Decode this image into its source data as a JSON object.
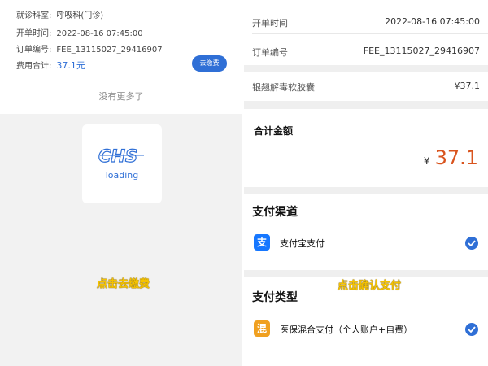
{
  "left": {
    "rows": [
      {
        "label": "就诊科室:",
        "value": "呼吸科(门诊)"
      },
      {
        "label": "开单时间:",
        "value": "2022-08-16 07:45:00"
      },
      {
        "label": "订单编号:",
        "value": "FEE_13115027_29416907"
      },
      {
        "label": "费用合计:",
        "value": "37.1元"
      }
    ],
    "pay_button": "去缴费",
    "no_more": "没有更多了",
    "loading_logo": "CHS",
    "loading": "loading",
    "caption": "点击去缴费"
  },
  "right": {
    "open_time_label": "开单时间",
    "open_time_value": "2022-08-16 07:45:00",
    "order_label": "订单编号",
    "order_value": "FEE_13115027_29416907",
    "item_name": "银翘解毒软胶囊",
    "item_price": "¥37.1",
    "total_label": "合计金额",
    "total_currency": "¥",
    "total_value": "37.1",
    "channel_title": "支付渠道",
    "channel_option": "支付宝支付",
    "channel_icon": "支",
    "type_title": "支付类型",
    "type_option": "医保混合支付（个人账户+自费）",
    "type_icon": "混",
    "caption": "点击确认支付"
  },
  "colors": {
    "accent_blue": "#2f6fd6",
    "amount_orange": "#d9541e",
    "caption_yellow": "#f5c300",
    "alipay_blue": "#1677ff",
    "mixed_orange": "#f0a020"
  }
}
